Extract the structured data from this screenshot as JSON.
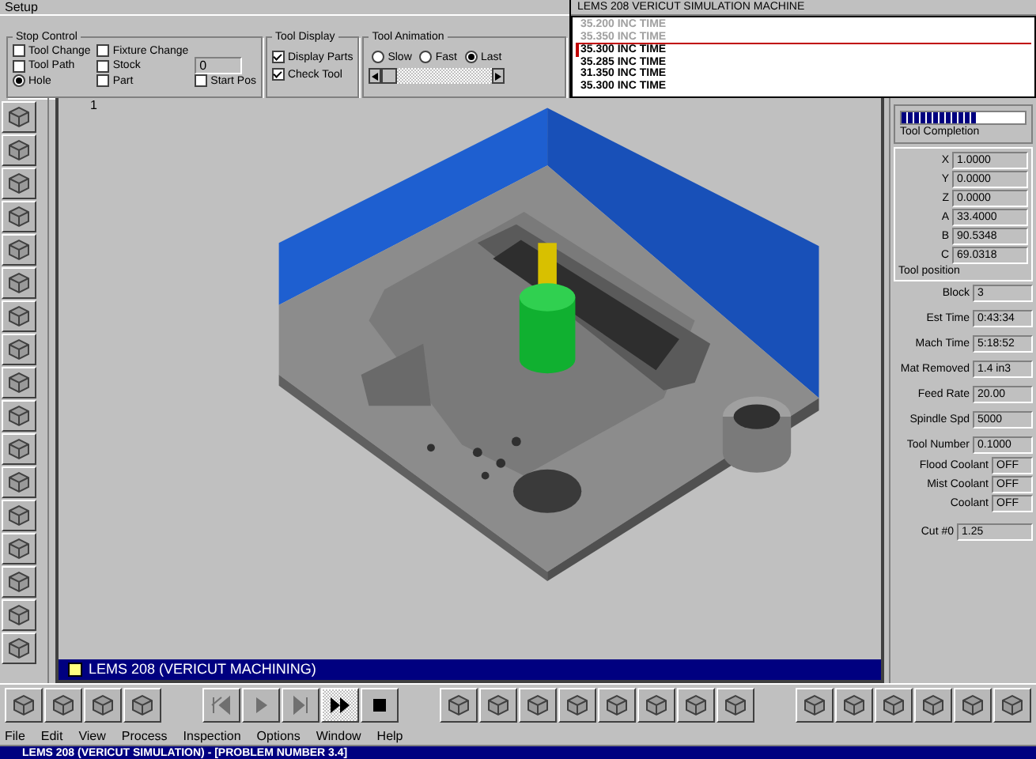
{
  "setup_panel": {
    "title": "Setup"
  },
  "stop_control": {
    "label": "Stop Control",
    "options": [
      {
        "label": "Tool Change",
        "kind": "checkbox",
        "checked": false
      },
      {
        "label": "Fixture Change",
        "kind": "checkbox",
        "checked": false
      },
      {
        "label": "Tool Path",
        "kind": "checkbox",
        "checked": false
      },
      {
        "label": "Stock",
        "kind": "checkbox",
        "checked": false
      },
      {
        "label": "Hole",
        "kind": "radio",
        "checked": true
      },
      {
        "label": "Part",
        "kind": "checkbox",
        "checked": false
      },
      {
        "label": "Start Pos",
        "kind": "checkbox",
        "checked": false
      }
    ],
    "count_field": {
      "value": "0"
    }
  },
  "tool_display": {
    "label": "Tool Display",
    "options": [
      {
        "label": "Display Parts",
        "checked": true
      },
      {
        "label": "Check Tool",
        "checked": true
      }
    ]
  },
  "tool_animation": {
    "label": "Tool Animation",
    "speeds": [
      {
        "label": "Slow",
        "selected": false
      },
      {
        "label": "Fast",
        "selected": false
      },
      {
        "label": "Last",
        "selected": true
      }
    ],
    "slider": {
      "level": 0
    }
  },
  "log": {
    "header": "LEMS 208 VERICUT SIMULATION MACHINE",
    "lines": [
      {
        "text": "35.200 INC TIME",
        "dimmed": true,
        "selected": false
      },
      {
        "text": "35.350 INC TIME",
        "dimmed": true,
        "selected": false
      },
      {
        "text": "35.300 INC TIME",
        "dimmed": false,
        "selected": true
      },
      {
        "text": "35.285 INC TIME",
        "dimmed": false,
        "selected": false
      },
      {
        "text": "31.350 INC TIME",
        "dimmed": false,
        "selected": false
      },
      {
        "text": "35.300 INC TIME",
        "dimmed": false,
        "selected": false
      }
    ]
  },
  "viewport": {
    "axis_label": "1",
    "title": "LEMS 208 (VERICUT MACHINING)"
  },
  "status_panel": {
    "completion": {
      "label": "Tool Completion",
      "level": 0.62
    },
    "position": {
      "label": "Tool position",
      "axes": [
        {
          "axis": "X",
          "value": "1.0000"
        },
        {
          "axis": "Y",
          "value": "0.0000"
        },
        {
          "axis": "Z",
          "value": "0.0000"
        },
        {
          "axis": "A",
          "value": "33.4000"
        },
        {
          "axis": "B",
          "value": "90.5348"
        },
        {
          "axis": "C",
          "value": "69.0318"
        }
      ]
    },
    "fields": [
      {
        "label": "Block",
        "value": "3"
      },
      {
        "label": "Est Time",
        "value": "0:43:34"
      },
      {
        "label": "Mach Time",
        "value": "5:18:52"
      },
      {
        "label": "Mat Removed",
        "value": "1.4 in3"
      },
      {
        "label": "Feed Rate",
        "value": "20.00"
      },
      {
        "label": "Spindle Spd",
        "value": "5000"
      },
      {
        "label": "Tool Number",
        "value": "0.1000"
      }
    ],
    "coolants": [
      {
        "label": "Flood Coolant",
        "value": "OFF"
      },
      {
        "label": "Mist Coolant",
        "value": "OFF"
      },
      {
        "label": "Coolant",
        "value": "OFF"
      }
    ],
    "cut": {
      "label": "Cut #0",
      "value": "1.25"
    }
  },
  "playback": [
    {
      "selected": false
    },
    {
      "selected": false
    },
    {
      "selected": false
    },
    {
      "selected": true
    },
    {
      "selected": false
    }
  ],
  "menu": [
    "File",
    "Edit",
    "View",
    "Process",
    "Inspection",
    "Options",
    "Window",
    "Help"
  ],
  "window": {
    "title": "LEMS 208 (VERICUT SIMULATION) - [PROBLEM NUMBER 3.4]"
  }
}
